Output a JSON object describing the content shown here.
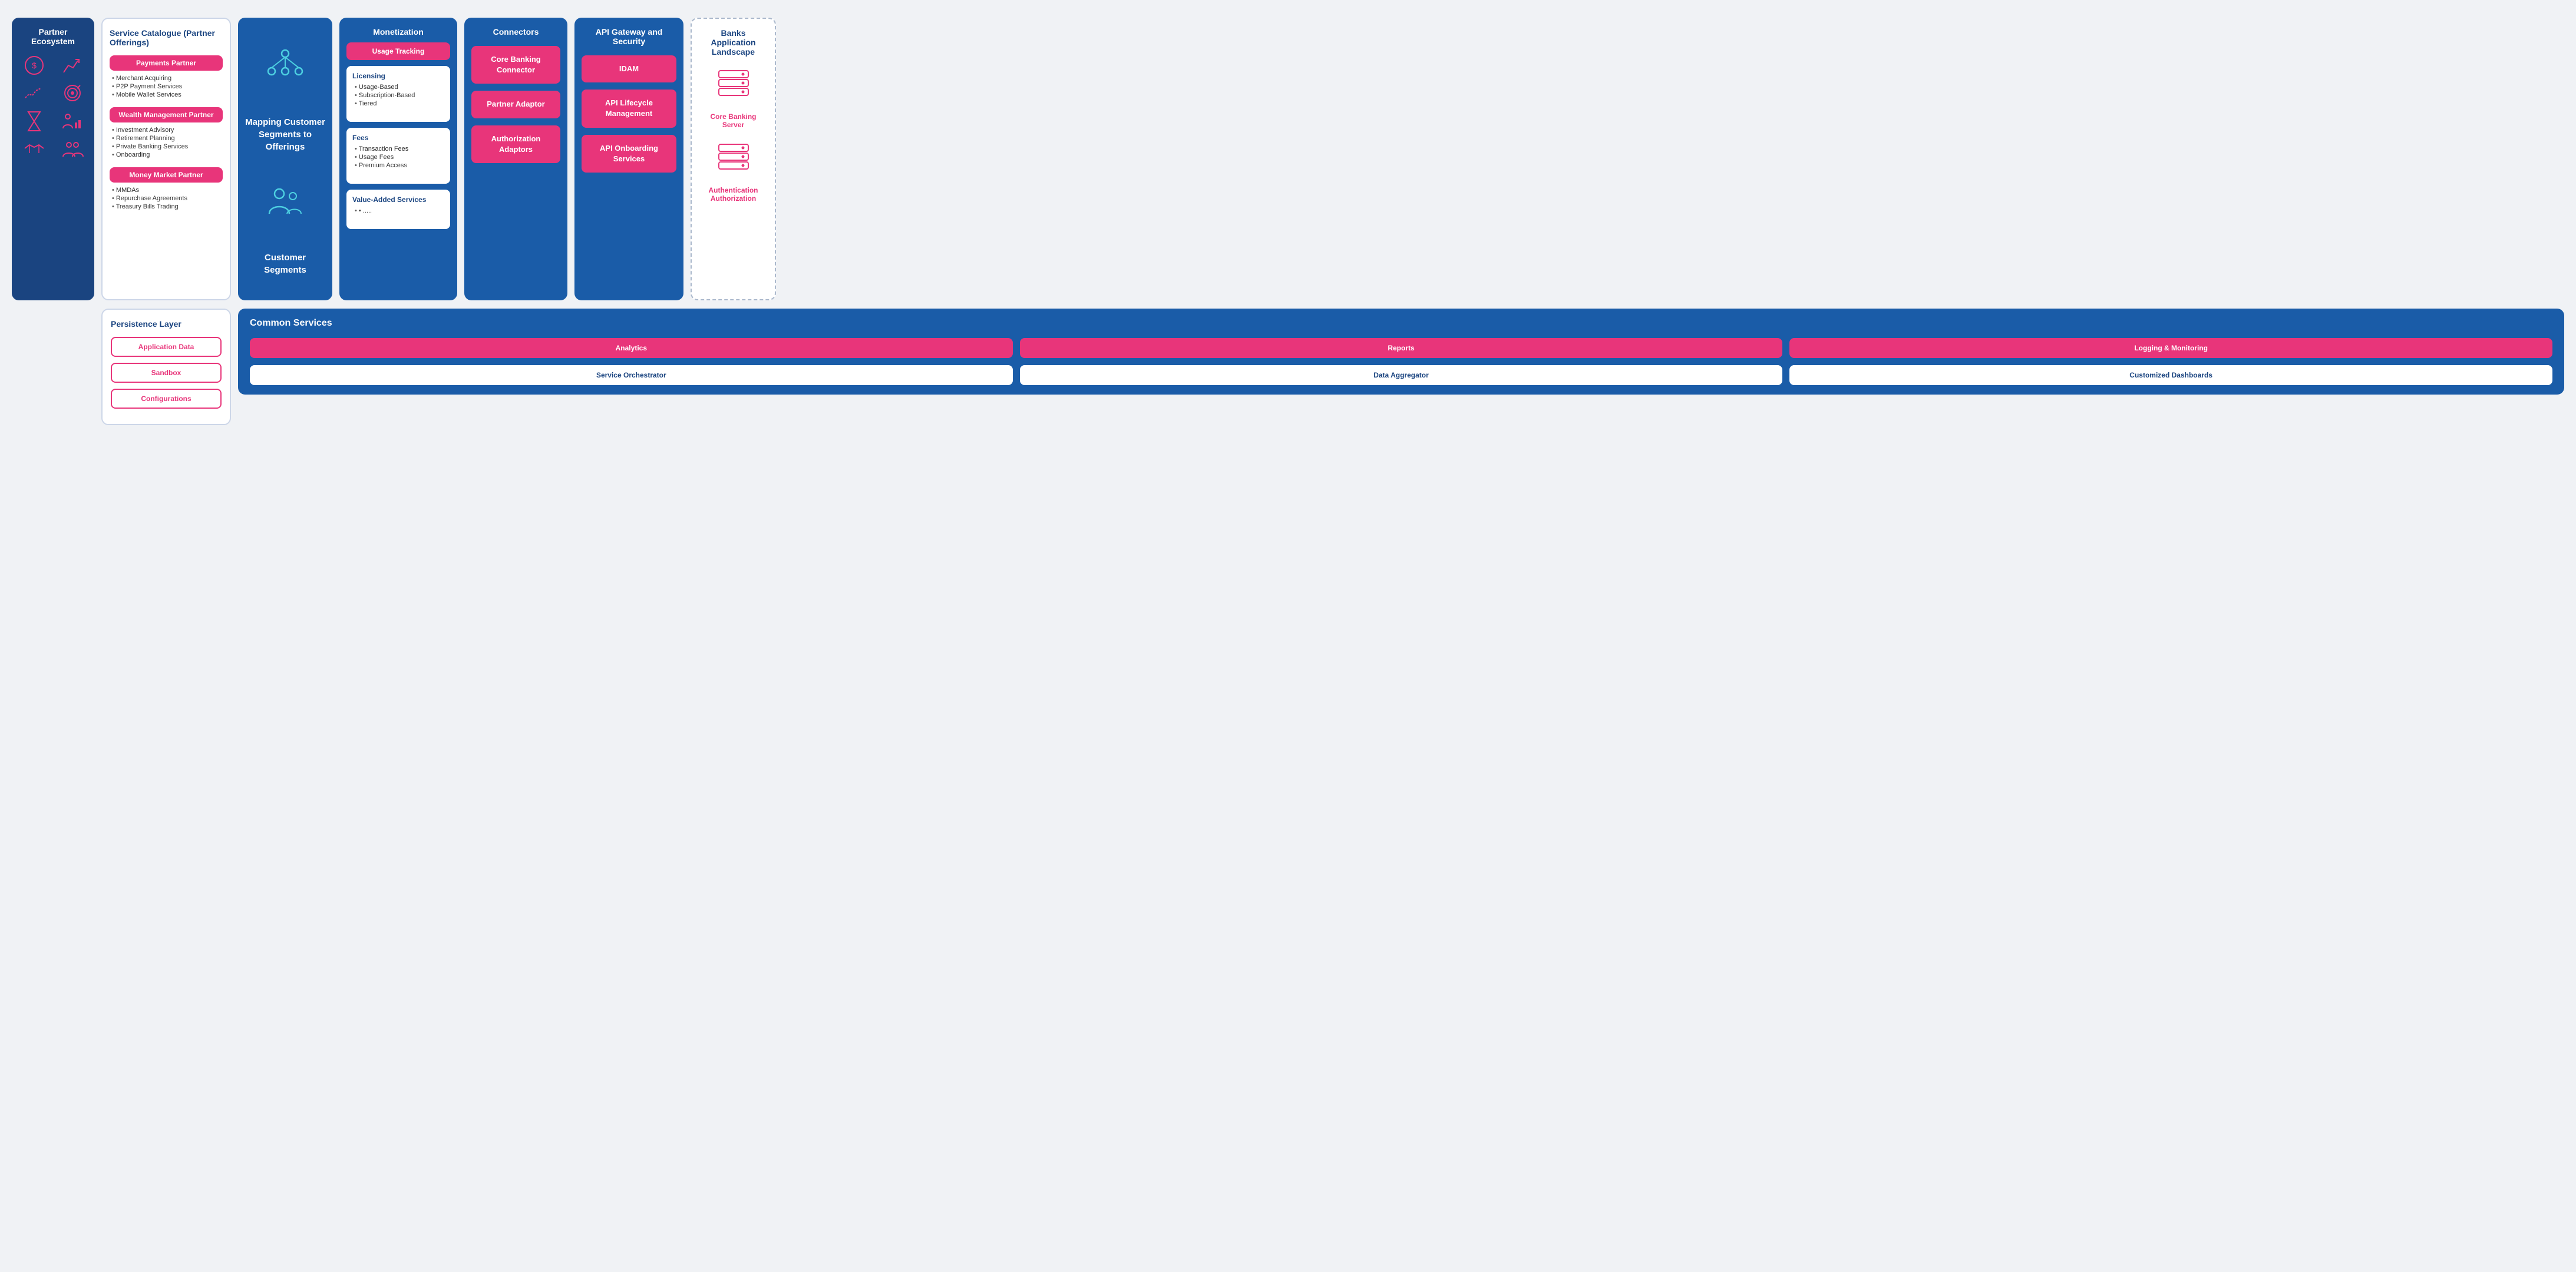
{
  "partnerEcosystem": {
    "title": "Partner Ecosystem",
    "icons": [
      "💰",
      "📈",
      "〰",
      "🎯",
      "⏳",
      "👤",
      "🤝",
      "👥"
    ]
  },
  "serviceCatalogue": {
    "title": "Service Catalogue (Partner Offerings)",
    "sections": [
      {
        "badge": "Payments Partner",
        "items": [
          "Merchant Acquiring",
          "P2P Payment Services",
          "Mobile Wallet Services"
        ]
      },
      {
        "badge": "Wealth Management Partner",
        "items": [
          "Investment Advisory",
          "Retirement Planning",
          "Private Banking Services",
          "Onboarding"
        ]
      },
      {
        "badge": "Money Market Partner",
        "items": [
          "MMDAs",
          "Repurchase Agreements",
          "Treasury Bills Trading"
        ]
      }
    ]
  },
  "mapping": {
    "title": "Mapping Customer Segments to Offerings",
    "subtitle": "Customer Segments"
  },
  "monetization": {
    "title": "Monetization",
    "usageTracking": "Usage Tracking",
    "licensing": {
      "title": "Licensing",
      "items": [
        "Usage-Based",
        "Subscription-Based",
        "Tiered"
      ]
    },
    "fees": {
      "title": "Fees",
      "items": [
        "Transaction Fees",
        "Usage Fees",
        "Premium Access"
      ]
    },
    "valueAdded": {
      "title": "Value-Added Services",
      "items": [
        "• ....."
      ]
    }
  },
  "connectors": {
    "title": "Connectors",
    "items": [
      "Core Banking Connector",
      "Partner Adaptor",
      "Authorization Adaptors"
    ]
  },
  "apiGateway": {
    "title": "API Gateway and Security",
    "items": [
      "IDAM",
      "API Lifecycle Management",
      "API Onboarding Services"
    ]
  },
  "banksApplication": {
    "title": "Banks Application Landscape",
    "coreServer": "Core Banking Server",
    "authLabel": "Authentication Authorization"
  },
  "persistenceLayer": {
    "title": "Persistence Layer",
    "items": [
      "Application Data",
      "Sandbox",
      "Configurations"
    ]
  },
  "commonServices": {
    "title": "Common Services",
    "row1": [
      "Analytics",
      "Reports",
      "Logging & Monitoring"
    ],
    "row2": [
      "Service Orchestrator",
      "Data Aggregator",
      "Customized Dashboards"
    ]
  }
}
